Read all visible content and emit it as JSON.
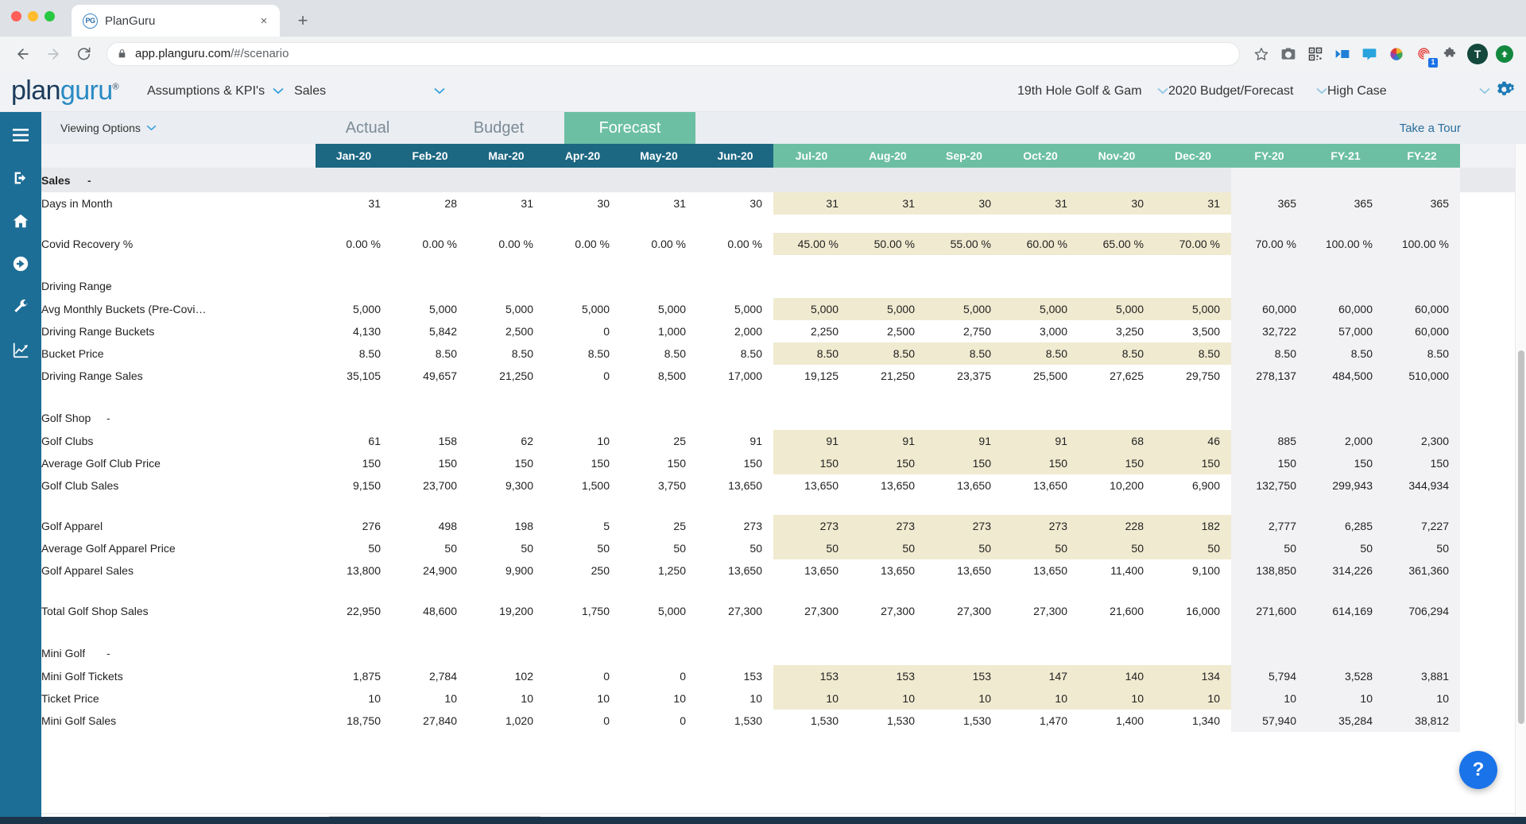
{
  "browser": {
    "tab_title": "PlanGuru",
    "favicon_text": "PG",
    "close_label": "×",
    "new_tab_label": "+",
    "back_icon": "back-arrow-icon",
    "forward_icon": "forward-arrow-icon",
    "reload_icon": "reload-icon",
    "url_host": "app.planguru.com",
    "url_path": "/#/scenario",
    "lock_icon": "lock-icon",
    "star_icon": "bookmark-star-icon",
    "extension_badge_count": "1",
    "profile_initial": "T"
  },
  "header": {
    "logo_plan": "plan",
    "logo_guru": "guru",
    "logo_registered": "®",
    "nav": [
      {
        "label": "Assumptions & KPI's",
        "caret": "⌄"
      },
      {
        "label": "Sales",
        "caret": "⌄"
      }
    ],
    "selectors": [
      {
        "label": "19th Hole Golf & Gam",
        "caret": "⌄"
      },
      {
        "label": "2020 Budget/Forecast",
        "caret": "⌄"
      },
      {
        "label": "High Case",
        "caret": "⌄"
      }
    ],
    "gear_icon": "gear-icon"
  },
  "sidebar": {
    "items": [
      {
        "icon": "hamburger-menu-icon"
      },
      {
        "icon": "logout-icon"
      },
      {
        "icon": "home-icon"
      },
      {
        "icon": "arrow-circle-right-icon"
      },
      {
        "icon": "wrench-icon"
      },
      {
        "icon": "chart-line-icon"
      }
    ]
  },
  "options_bar": {
    "viewing_options": "Viewing Options",
    "viewing_options_caret": "⌄",
    "take_a_tour": "Take a Tour"
  },
  "tabs": [
    {
      "label": "Actual",
      "active": false
    },
    {
      "label": "Budget",
      "active": false
    },
    {
      "label": "Forecast",
      "active": true
    }
  ],
  "grid": {
    "label_header": "",
    "columns": [
      {
        "label": "Jan-20",
        "kind": "actual"
      },
      {
        "label": "Feb-20",
        "kind": "actual"
      },
      {
        "label": "Mar-20",
        "kind": "actual"
      },
      {
        "label": "Apr-20",
        "kind": "actual"
      },
      {
        "label": "May-20",
        "kind": "actual"
      },
      {
        "label": "Jun-20",
        "kind": "actual"
      },
      {
        "label": "Jul-20",
        "kind": "forecast"
      },
      {
        "label": "Aug-20",
        "kind": "forecast"
      },
      {
        "label": "Sep-20",
        "kind": "forecast"
      },
      {
        "label": "Oct-20",
        "kind": "forecast"
      },
      {
        "label": "Nov-20",
        "kind": "forecast"
      },
      {
        "label": "Dec-20",
        "kind": "forecast"
      },
      {
        "label": "FY-20",
        "kind": "forecast"
      },
      {
        "label": "FY-21",
        "kind": "forecast"
      },
      {
        "label": "FY-22",
        "kind": "forecast"
      }
    ],
    "rows": [
      {
        "type": "group",
        "label": "Sales",
        "marker": "-",
        "indent": 0
      },
      {
        "type": "data",
        "label": "Days in Month",
        "indent": 1,
        "input": true,
        "values": [
          "31",
          "28",
          "31",
          "30",
          "31",
          "30",
          "31",
          "31",
          "30",
          "31",
          "30",
          "31",
          "365",
          "365",
          "365"
        ]
      },
      {
        "type": "spacer"
      },
      {
        "type": "data",
        "label": "Covid Recovery %",
        "indent": 1,
        "input": true,
        "values": [
          "0.00 %",
          "0.00 %",
          "0.00 %",
          "0.00 %",
          "0.00 %",
          "0.00 %",
          "45.00 %",
          "50.00 %",
          "55.00 %",
          "60.00 %",
          "65.00 %",
          "70.00 %",
          "70.00 %",
          "100.00 %",
          "100.00 %"
        ]
      },
      {
        "type": "spacer"
      },
      {
        "type": "section",
        "label": "Driving Range",
        "marker": "-",
        "indent": 1
      },
      {
        "type": "data",
        "label": "Avg Monthly Buckets (Pre-Covi…",
        "indent": 2,
        "input": true,
        "values": [
          "5,000",
          "5,000",
          "5,000",
          "5,000",
          "5,000",
          "5,000",
          "5,000",
          "5,000",
          "5,000",
          "5,000",
          "5,000",
          "5,000",
          "60,000",
          "60,000",
          "60,000"
        ]
      },
      {
        "type": "data",
        "label": "Driving Range Buckets",
        "indent": 2,
        "input": false,
        "values": [
          "4,130",
          "5,842",
          "2,500",
          "0",
          "1,000",
          "2,000",
          "2,250",
          "2,500",
          "2,750",
          "3,000",
          "3,250",
          "3,500",
          "32,722",
          "57,000",
          "60,000"
        ]
      },
      {
        "type": "data",
        "label": "Bucket Price",
        "indent": 2,
        "input": true,
        "values": [
          "8.50",
          "8.50",
          "8.50",
          "8.50",
          "8.50",
          "8.50",
          "8.50",
          "8.50",
          "8.50",
          "8.50",
          "8.50",
          "8.50",
          "8.50",
          "8.50",
          "8.50"
        ]
      },
      {
        "type": "data",
        "label": "Driving Range Sales",
        "indent": 2,
        "input": false,
        "values": [
          "35,105",
          "49,657",
          "21,250",
          "0",
          "8,500",
          "17,000",
          "19,125",
          "21,250",
          "23,375",
          "25,500",
          "27,625",
          "29,750",
          "278,137",
          "484,500",
          "510,000"
        ]
      },
      {
        "type": "spacer"
      },
      {
        "type": "section",
        "label": "Golf Shop",
        "marker": "-",
        "indent": 1
      },
      {
        "type": "data",
        "label": "Golf Clubs",
        "indent": 2,
        "input": true,
        "values": [
          "61",
          "158",
          "62",
          "10",
          "25",
          "91",
          "91",
          "91",
          "91",
          "91",
          "68",
          "46",
          "885",
          "2,000",
          "2,300"
        ]
      },
      {
        "type": "data",
        "label": "Average Golf Club Price",
        "indent": 2,
        "input": true,
        "values": [
          "150",
          "150",
          "150",
          "150",
          "150",
          "150",
          "150",
          "150",
          "150",
          "150",
          "150",
          "150",
          "150",
          "150",
          "150"
        ]
      },
      {
        "type": "data",
        "label": "Golf Club Sales",
        "indent": 2,
        "input": false,
        "values": [
          "9,150",
          "23,700",
          "9,300",
          "1,500",
          "3,750",
          "13,650",
          "13,650",
          "13,650",
          "13,650",
          "13,650",
          "10,200",
          "6,900",
          "132,750",
          "299,943",
          "344,934"
        ]
      },
      {
        "type": "spacer"
      },
      {
        "type": "data",
        "label": "Golf Apparel",
        "indent": 2,
        "input": true,
        "values": [
          "276",
          "498",
          "198",
          "5",
          "25",
          "273",
          "273",
          "273",
          "273",
          "273",
          "228",
          "182",
          "2,777",
          "6,285",
          "7,227"
        ]
      },
      {
        "type": "data",
        "label": "Average Golf Apparel Price",
        "indent": 2,
        "input": true,
        "values": [
          "50",
          "50",
          "50",
          "50",
          "50",
          "50",
          "50",
          "50",
          "50",
          "50",
          "50",
          "50",
          "50",
          "50",
          "50"
        ]
      },
      {
        "type": "data",
        "label": "Golf Apparel Sales",
        "indent": 2,
        "input": false,
        "values": [
          "13,800",
          "24,900",
          "9,900",
          "250",
          "1,250",
          "13,650",
          "13,650",
          "13,650",
          "13,650",
          "13,650",
          "11,400",
          "9,100",
          "138,850",
          "314,226",
          "361,360"
        ]
      },
      {
        "type": "spacer"
      },
      {
        "type": "data",
        "label": "Total Golf Shop Sales",
        "indent": 2,
        "input": false,
        "values": [
          "22,950",
          "48,600",
          "19,200",
          "1,750",
          "5,000",
          "27,300",
          "27,300",
          "27,300",
          "27,300",
          "27,300",
          "21,600",
          "16,000",
          "271,600",
          "614,169",
          "706,294"
        ]
      },
      {
        "type": "spacer"
      },
      {
        "type": "section",
        "label": "Mini Golf",
        "marker": "-",
        "indent": 1
      },
      {
        "type": "data",
        "label": "Mini Golf Tickets",
        "indent": 2,
        "input": true,
        "values": [
          "1,875",
          "2,784",
          "102",
          "0",
          "0",
          "153",
          "153",
          "153",
          "153",
          "147",
          "140",
          "134",
          "5,794",
          "3,528",
          "3,881"
        ]
      },
      {
        "type": "data",
        "label": "Ticket Price",
        "indent": 2,
        "input": true,
        "values": [
          "10",
          "10",
          "10",
          "10",
          "10",
          "10",
          "10",
          "10",
          "10",
          "10",
          "10",
          "10",
          "10",
          "10",
          "10"
        ]
      },
      {
        "type": "data",
        "label": "Mini Golf Sales",
        "indent": 2,
        "input": false,
        "values": [
          "18,750",
          "27,840",
          "1,020",
          "0",
          "0",
          "1,530",
          "1,530",
          "1,530",
          "1,530",
          "1,470",
          "1,400",
          "1,340",
          "57,940",
          "35,284",
          "38,812"
        ]
      }
    ]
  },
  "help": {
    "label": "?"
  },
  "colors": {
    "actual_header": "#1c6782",
    "forecast_header": "#6cbfa3",
    "forecast_cell": "#f0ead0",
    "fy_cell": "#f2f2f4",
    "sidebar": "#1d6e96",
    "accent": "#2a8ac4"
  }
}
